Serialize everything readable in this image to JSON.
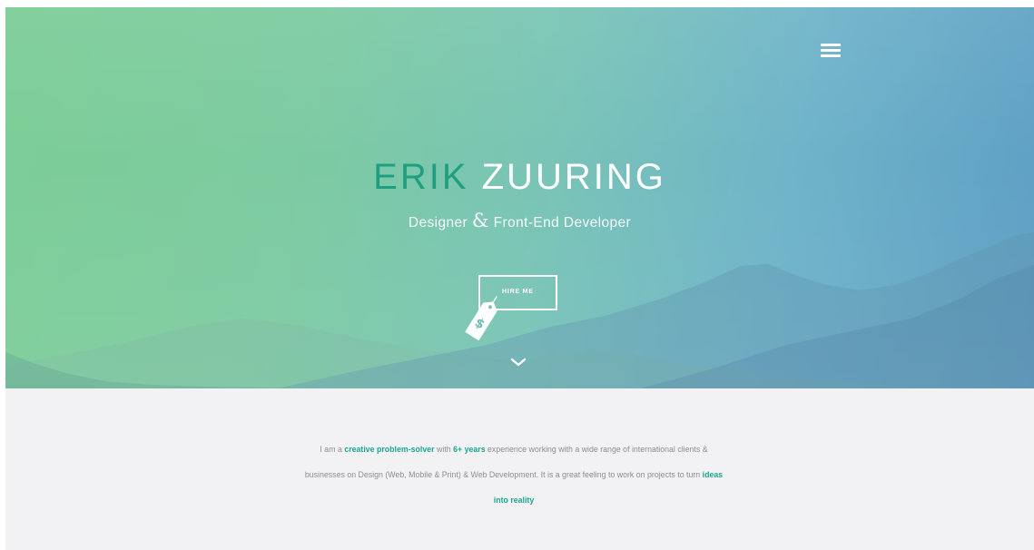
{
  "hero": {
    "first_name": "ERIK",
    "last_name": "ZUURING",
    "subtitle_left": "Designer",
    "subtitle_amp": "&",
    "subtitle_right": "Front-End Developer",
    "hire_label": "HIRE ME",
    "tag_symbol": "$"
  },
  "about": {
    "t1": "I am a ",
    "h1": "creative problem-solver",
    "t2": " with ",
    "h2": "6+ years",
    "t3": " experience working with a wide range of international clients & businesses on Design (Web, Mobile & Print) & Web Development. It is a great feeling to work on projects to turn ",
    "h3": "ideas into reality"
  },
  "icons": {
    "menu": "hamburger-menu-icon",
    "tag": "price-tag-icon",
    "scroll": "chevron-down-icon"
  },
  "colors": {
    "accent": "#1ba890",
    "hero_gradient_start": "#7ccd96",
    "hero_gradient_end": "#5d9ec4",
    "body_text": "#8c8c94",
    "background": "#f2f2f5"
  }
}
